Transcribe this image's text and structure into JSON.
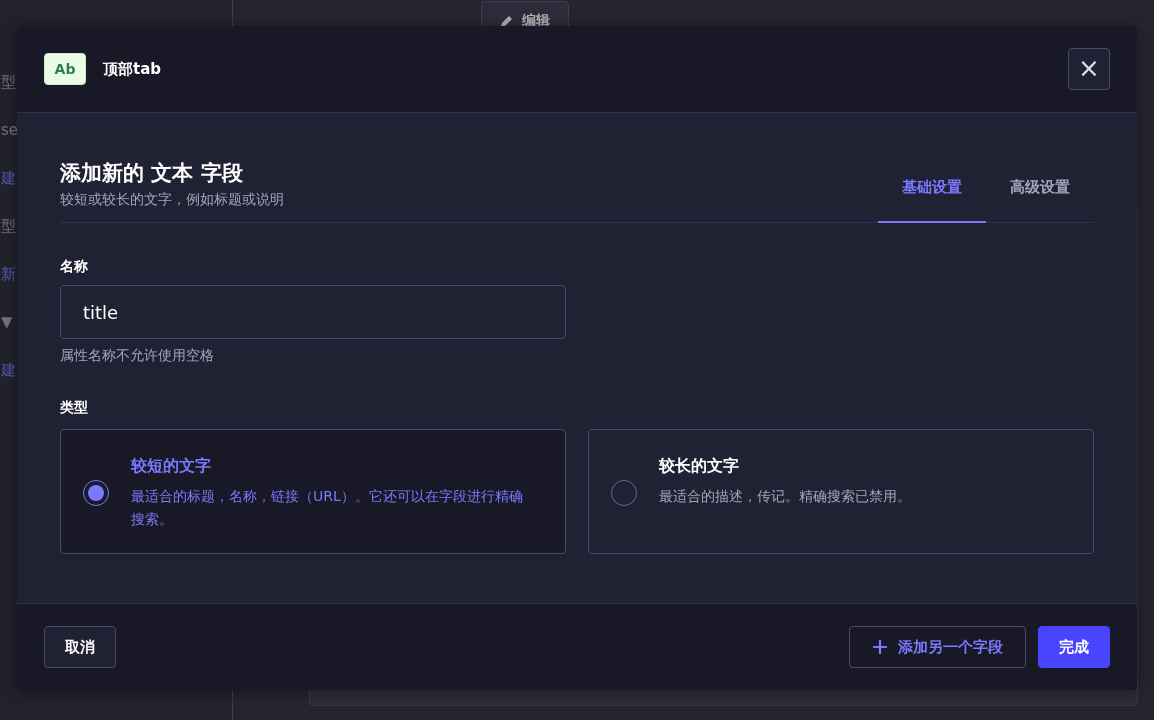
{
  "background": {
    "sidebar_items": [
      {
        "label": "型",
        "kind": "text"
      },
      {
        "label": "se",
        "kind": "text"
      },
      {
        "label": "建",
        "kind": "link"
      },
      {
        "label": "型",
        "kind": "text"
      },
      {
        "label": "新",
        "kind": "link"
      },
      {
        "label": "▼",
        "kind": "text"
      },
      {
        "label": "建",
        "kind": "link"
      }
    ],
    "edit_button": "编辑"
  },
  "modal": {
    "badge": "Ab",
    "title": "顶部tab",
    "close": "×",
    "heading": "添加新的 文本 字段",
    "subheading": "较短或较长的文字，例如标题或说明",
    "tabs": [
      {
        "label": "基础设置",
        "selected": true
      },
      {
        "label": "高级设置",
        "selected": false
      }
    ],
    "name_field": {
      "label": "名称",
      "value": "title",
      "hint": "属性名称不允许使用空格"
    },
    "type_label": "类型",
    "type_options": [
      {
        "title": "较短的文字",
        "description": "最适合的标题，名称，链接（URL）。它还可以在字段进行精确搜索。",
        "selected": true
      },
      {
        "title": "较长的文字",
        "description": "最适合的描述，传记。精确搜索已禁用。",
        "selected": false
      }
    ],
    "footer": {
      "cancel": "取消",
      "add_another": "添加另一个字段",
      "finish": "完成"
    }
  }
}
